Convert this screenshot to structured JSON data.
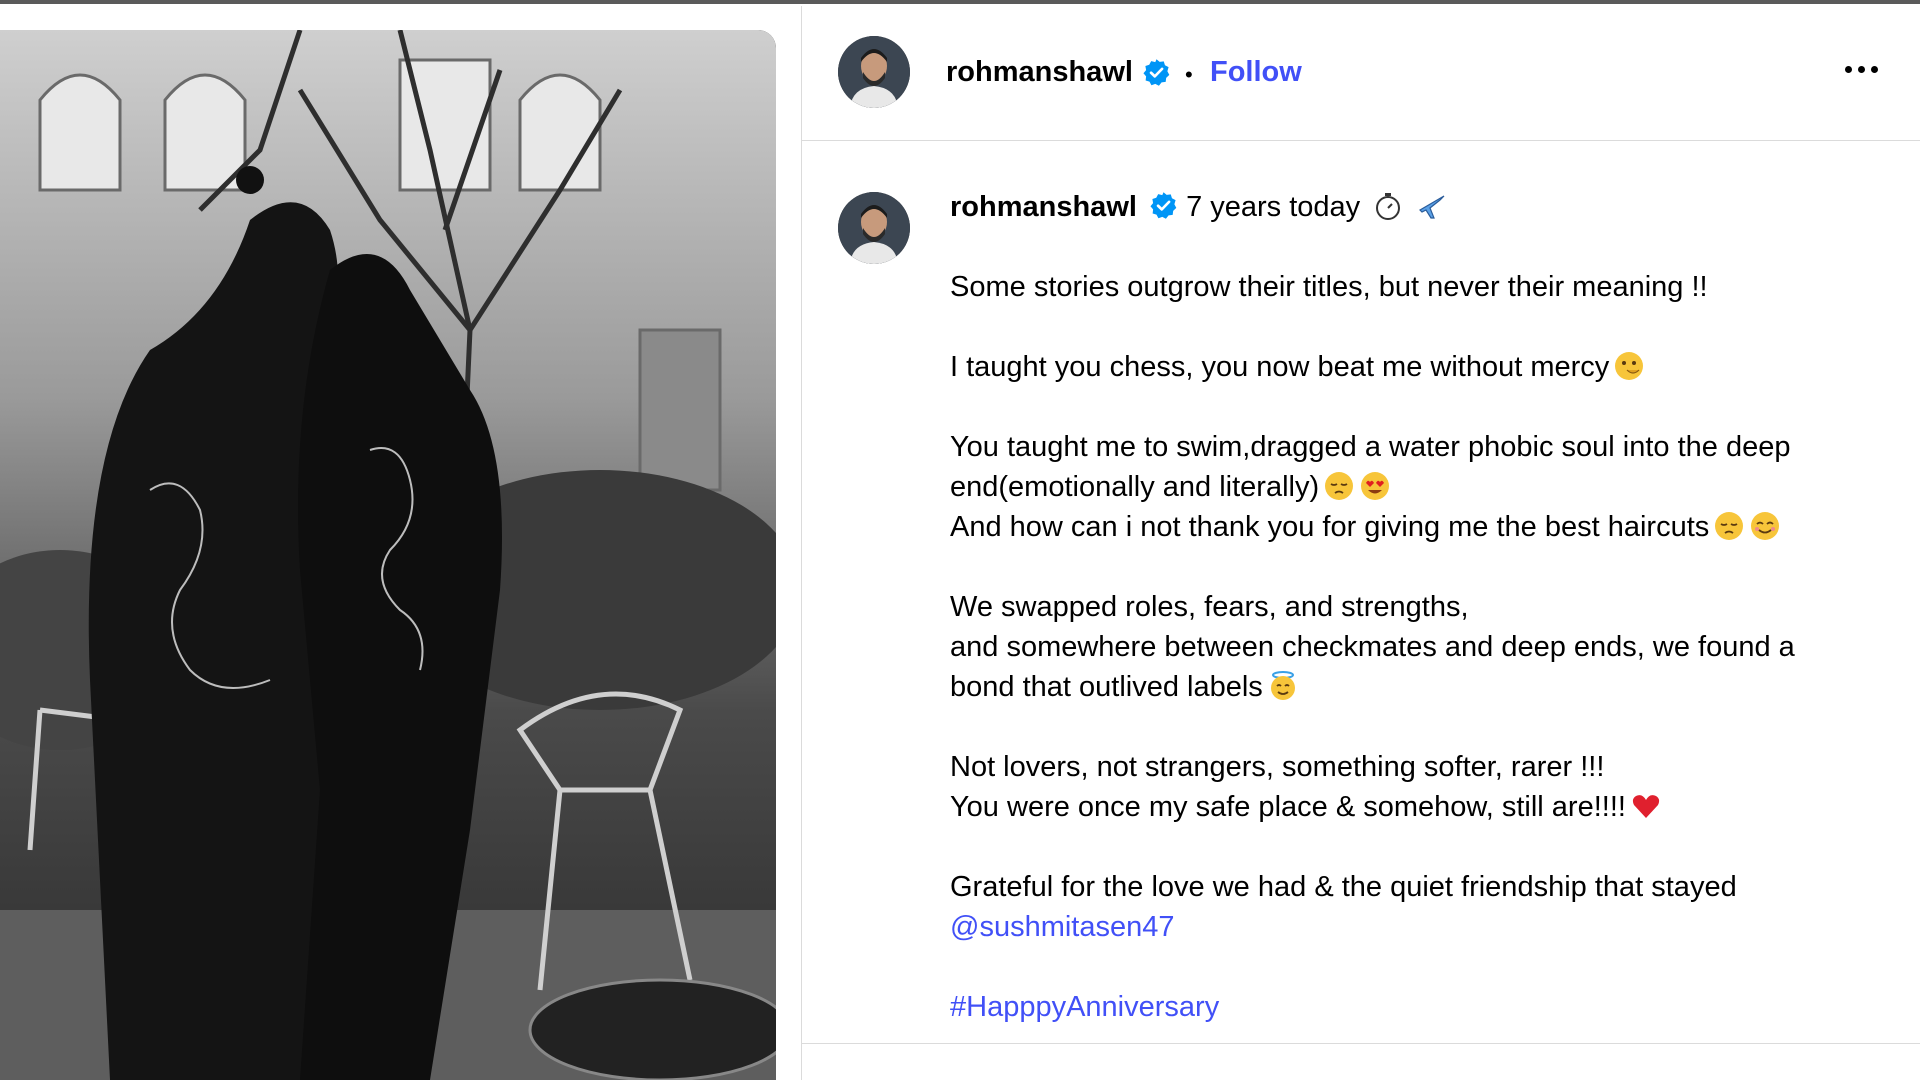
{
  "post": {
    "username": "rohmanshawl",
    "verified": true,
    "follow_label": "Follow",
    "separator": "•",
    "headline": "7 years today",
    "headline_emojis": [
      "stopwatch",
      "airplane"
    ],
    "caption_lines": [
      {
        "text": "Some stories outgrow their titles, but never their meaning !!"
      },
      {
        "gap": true
      },
      {
        "text": "I taught you chess, you now beat me without mercy",
        "emoji": [
          "face-with-hand-over-mouth"
        ]
      },
      {
        "gap": true
      },
      {
        "text": "You taught me to swim,dragged a water phobic soul into the deep"
      },
      {
        "text": "end(emotionally and literally)",
        "emoji": [
          "pensive-face",
          "heart-eyes-face"
        ]
      },
      {
        "text": "And how can i not thank you for giving me the best haircuts",
        "emoji": [
          "pensive-face",
          "relieved-face"
        ]
      },
      {
        "gap": true
      },
      {
        "text": "We swapped roles, fears, and strengths,"
      },
      {
        "text": "and somewhere between checkmates and deep ends, we found a"
      },
      {
        "text": "bond that outlived labels",
        "emoji": [
          "smiling-face-with-halo"
        ]
      },
      {
        "gap": true
      },
      {
        "text": "Not lovers, not strangers, something softer, rarer !!!"
      },
      {
        "text": "You were once my safe place & somehow, still are!!!!",
        "emoji": [
          "red-heart"
        ]
      },
      {
        "gap": true
      },
      {
        "text": "Grateful for the love we had & the quiet friendship that stayed"
      },
      {
        "text": "@sushmitasen47",
        "link": true
      },
      {
        "gap": true
      },
      {
        "text": "#HapppyAnniversary",
        "link": true
      }
    ]
  },
  "icons": {
    "more": "more-options-icon",
    "verified": "verified-badge-icon"
  },
  "colors": {
    "link": "#4150f7",
    "verified": "#0095f6",
    "divider": "#dbdbdb"
  }
}
